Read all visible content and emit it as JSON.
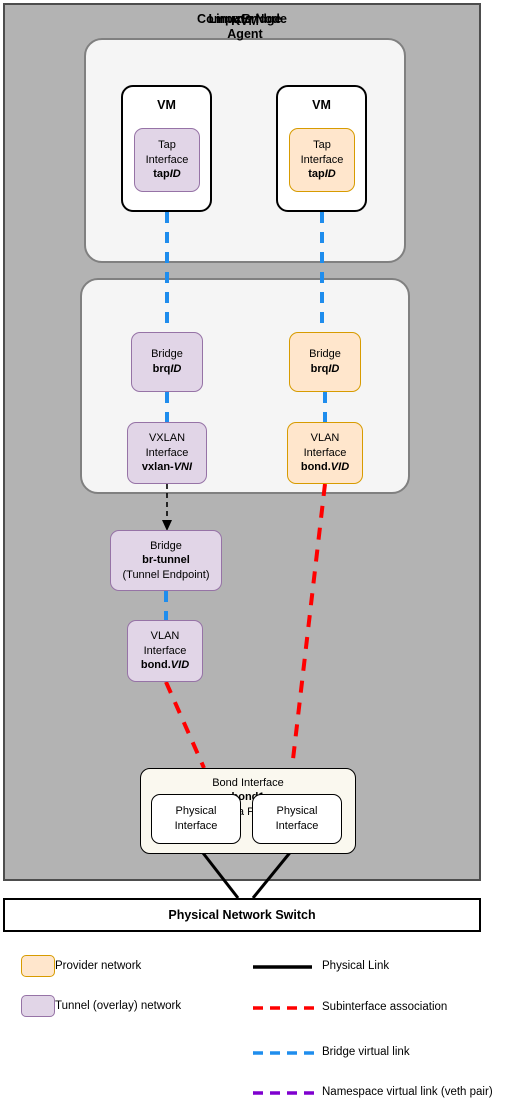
{
  "diagram": {
    "compute_node": {
      "title": "Compute Node"
    },
    "kvm": {
      "title": "KVM",
      "vms": [
        {
          "title": "VM",
          "tap": {
            "line1": "Tap",
            "line2": "Interface",
            "name_prefix": "tap",
            "name_italic": "ID",
            "network": "tunnel"
          }
        },
        {
          "title": "VM",
          "tap": {
            "line1": "Tap",
            "line2": "Interface",
            "name_prefix": "tap",
            "name_italic": "ID",
            "network": "provider"
          }
        }
      ]
    },
    "linuxbridge": {
      "title_line1": "LinuxBridge",
      "title_line2": "Agent",
      "bridges": [
        {
          "line1": "Bridge",
          "name_prefix": "brq",
          "name_italic": "ID",
          "network": "tunnel"
        },
        {
          "line1": "Bridge",
          "name_prefix": "brq",
          "name_italic": "ID",
          "network": "provider"
        }
      ],
      "interfaces": [
        {
          "line1": "VXLAN",
          "line2": "Interface",
          "name_prefix": "vxlan-",
          "name_italic": "VNI",
          "network": "tunnel"
        },
        {
          "line1": "VLAN",
          "line2": "Interface",
          "name_prefix": "bond.",
          "name_italic": "VID",
          "network": "provider"
        }
      ]
    },
    "br_tunnel": {
      "line1": "Bridge",
      "name": "br-tunnel",
      "line3": "(Tunnel Endpoint)",
      "network": "tunnel"
    },
    "vlan_interface_tunnel": {
      "line1": "VLAN",
      "line2": "Interface",
      "name_prefix": "bond.",
      "name_italic": "VID",
      "network": "tunnel"
    },
    "bond": {
      "line1": "Bond Interface",
      "name": "bond1",
      "line3": "(Data Plane)",
      "physical_interfaces": [
        {
          "line1": "Physical",
          "line2": "Interface"
        },
        {
          "line1": "Physical",
          "line2": "Interface"
        }
      ]
    },
    "switch": {
      "label": "Physical Network Switch"
    }
  },
  "legend": {
    "swatches": [
      {
        "label": "Provider network",
        "fill": "#ffe6cc",
        "stroke": "#d79b00"
      },
      {
        "label": "Tunnel (overlay) network",
        "fill": "#e1d5e7",
        "stroke": "#9673a6"
      }
    ],
    "lines": [
      {
        "label": "Physical Link",
        "color": "#000000",
        "style": "solid"
      },
      {
        "label": "Subinterface association",
        "color": "#ff0000",
        "style": "dashed"
      },
      {
        "label": "Bridge virtual link",
        "color": "#1f8ded",
        "style": "dashed"
      },
      {
        "label": "Namespace virtual link (veth pair)",
        "color": "#7f00cf",
        "style": "dashed"
      }
    ]
  },
  "colors": {
    "compute_node_bg": "#b3b3b3",
    "compute_node_border": "#4d4d4d",
    "group_bg": "#f5f5f5",
    "group_border": "#808080",
    "tunnel_fill": "#e1d5e7",
    "tunnel_stroke": "#9673a6",
    "provider_fill": "#ffe6cc",
    "provider_stroke": "#d79b00",
    "bond_fill": "#faf8ef",
    "bridge_link": "#1f8ded",
    "subinterface_link": "#ff0000",
    "physical_link": "#000000",
    "namespace_link": "#7f00cf"
  }
}
